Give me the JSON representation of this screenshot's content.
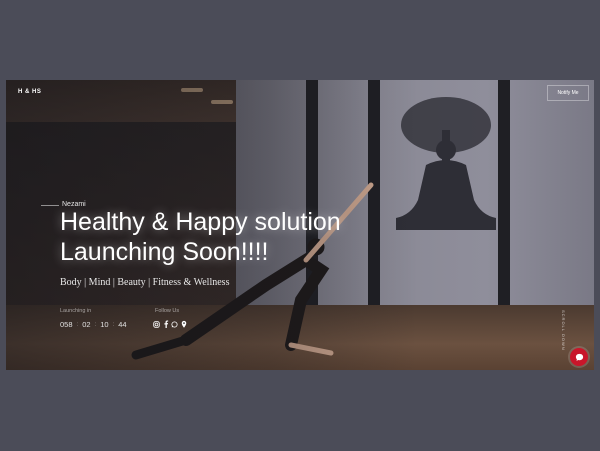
{
  "header": {
    "logo_text": "H & HS",
    "notify_label": "Notify Me"
  },
  "hero": {
    "brand": "Nezami",
    "headline_line1": "Healthy & Happy solution",
    "headline_line2": "Launching Soon!!!!",
    "subline": "Body | Mind | Beauty | Fitness & Wellness"
  },
  "countdown": {
    "label": "Launching in",
    "days": "058",
    "hours": "02",
    "minutes": "10",
    "seconds": "44",
    "separator": ":"
  },
  "social": {
    "label": "Follow Us",
    "icons": [
      "instagram-icon",
      "facebook-icon",
      "whatsapp-icon",
      "location-pin-icon"
    ]
  },
  "side_text": "SCROLL DOWN",
  "chat": {
    "icon": "chat-bubble-icon",
    "color": "#c8162a"
  }
}
